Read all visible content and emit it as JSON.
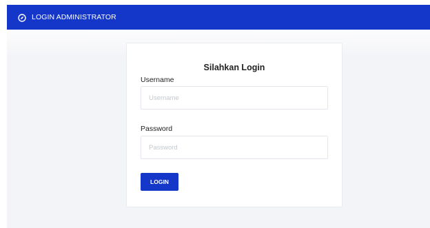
{
  "header": {
    "title": "LOGIN ADMINISTRATOR",
    "icon": "compass-icon",
    "color": "#1537c9"
  },
  "form": {
    "title": "Silahkan Login",
    "username": {
      "label": "Username",
      "placeholder": "Username",
      "value": ""
    },
    "password": {
      "label": "Password",
      "placeholder": "Password",
      "value": ""
    },
    "submit_label": "LOGIN"
  },
  "colors": {
    "accent": "#1537c9",
    "background": "#f3f4f7",
    "card": "#ffffff"
  }
}
